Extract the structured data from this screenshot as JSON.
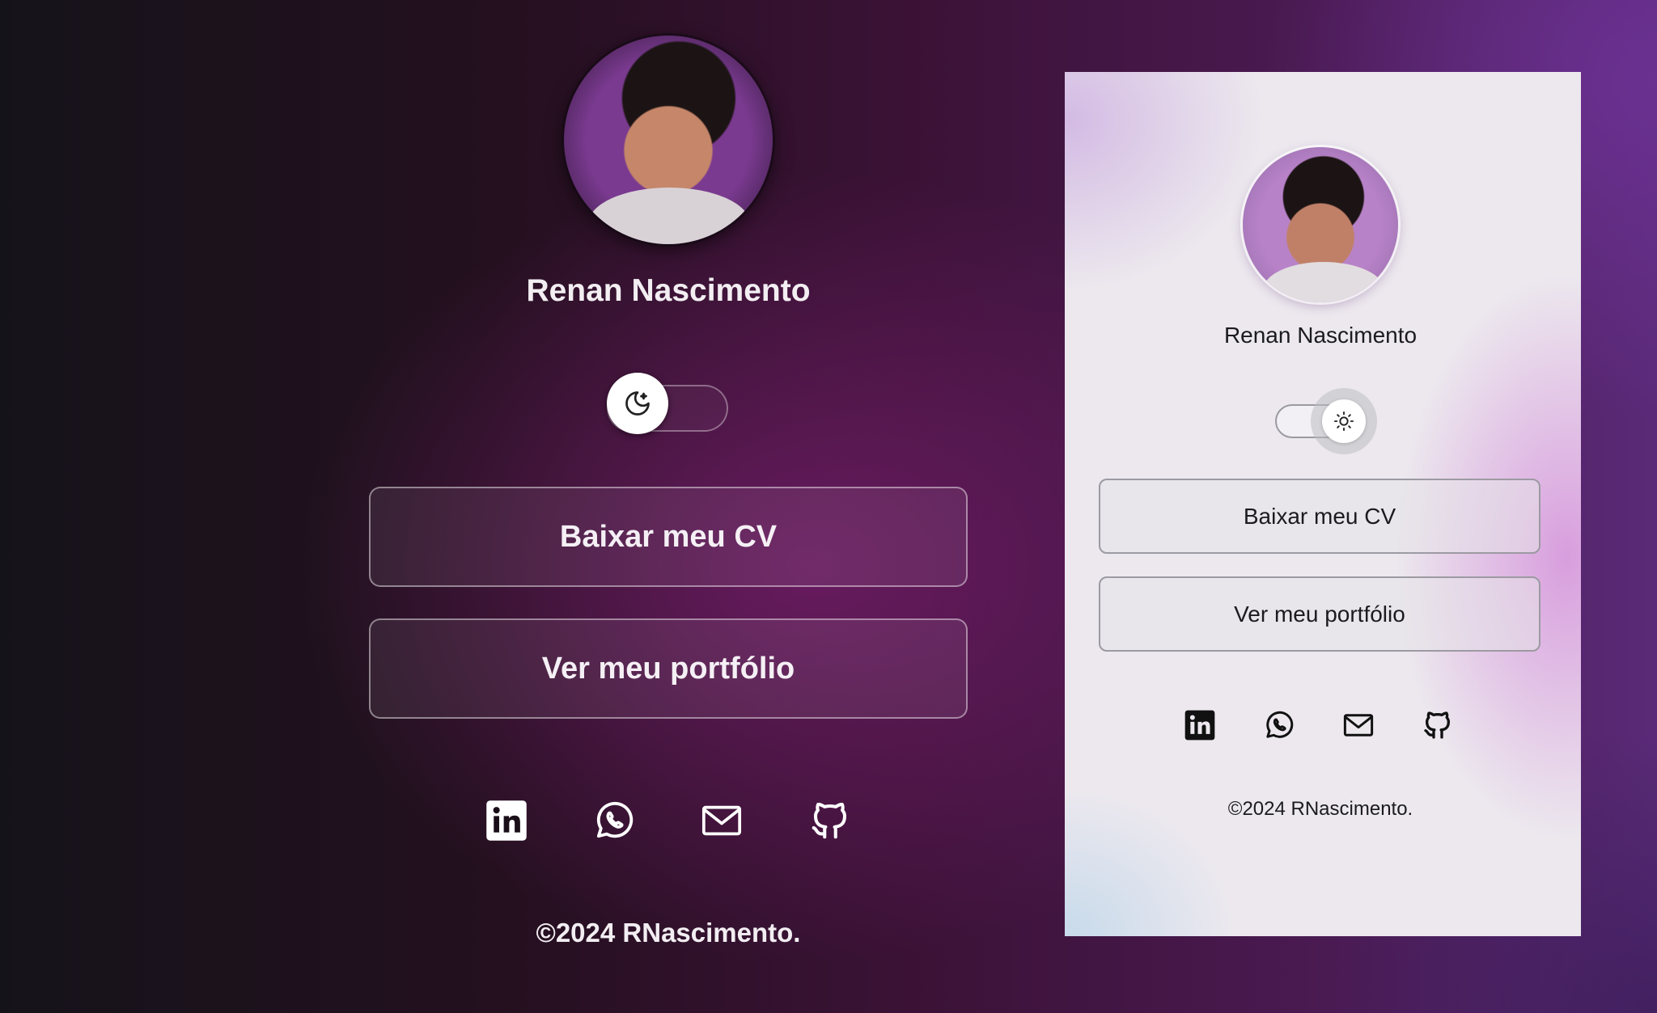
{
  "dark_card": {
    "theme": "dark",
    "name": "Renan Nascimento",
    "toggle_icon": "moon-stars-icon",
    "buttons": {
      "cv_label": "Baixar meu CV",
      "portfolio_label": "Ver meu portfólio"
    },
    "social_icons": [
      "linkedin-icon",
      "whatsapp-icon",
      "mail-icon",
      "github-icon"
    ],
    "footer": "©2024 RNascimento."
  },
  "light_card": {
    "theme": "light",
    "name": "Renan Nascimento",
    "toggle_icon": "sun-icon",
    "buttons": {
      "cv_label": "Baixar meu CV",
      "portfolio_label": "Ver meu portfólio"
    },
    "social_icons": [
      "linkedin-icon",
      "whatsapp-icon",
      "mail-icon",
      "github-icon"
    ],
    "footer": "©2024 RNascimento."
  },
  "colors": {
    "dark_background": "#24101f",
    "accent_purple": "#5a2a78",
    "light_card_background": "#ece8ee",
    "dark_text": "#f2eef2",
    "light_text": "#1b1b1f"
  }
}
